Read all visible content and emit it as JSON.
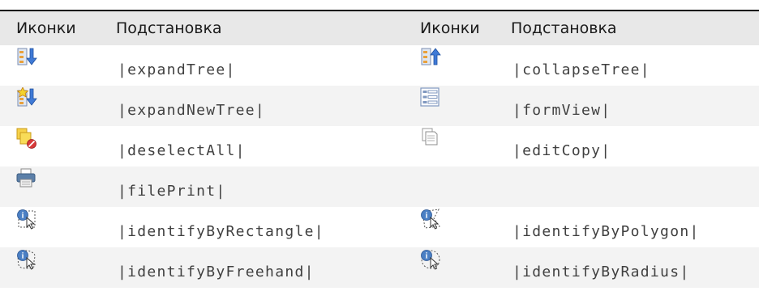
{
  "table": {
    "headers": [
      "Иконки",
      "Подстановка",
      "Иконки",
      "Подстановка"
    ],
    "rows": [
      [
        {
          "icon": "expand-tree-icon",
          "text": "|expandTree|"
        },
        {
          "icon": "collapse-tree-icon",
          "text": "|collapseTree|"
        }
      ],
      [
        {
          "icon": "expand-new-tree-icon",
          "text": "|expandNewTree|"
        },
        {
          "icon": "form-view-icon",
          "text": "|formView|"
        }
      ],
      [
        {
          "icon": "deselect-all-icon",
          "text": "|deselectAll|"
        },
        {
          "icon": "edit-copy-icon",
          "text": "|editCopy|"
        }
      ],
      [
        {
          "icon": "file-print-icon",
          "text": "|filePrint|"
        },
        {
          "icon": "",
          "text": ""
        }
      ],
      [
        {
          "icon": "identify-by-rectangle-icon",
          "text": "|identifyByRectangle|"
        },
        {
          "icon": "identify-by-polygon-icon",
          "text": "|identifyByPolygon|"
        }
      ],
      [
        {
          "icon": "identify-by-freehand-icon",
          "text": "|identifyByFreehand|"
        },
        {
          "icon": "identify-by-radius-icon",
          "text": "|identifyByRadius|"
        }
      ]
    ]
  }
}
